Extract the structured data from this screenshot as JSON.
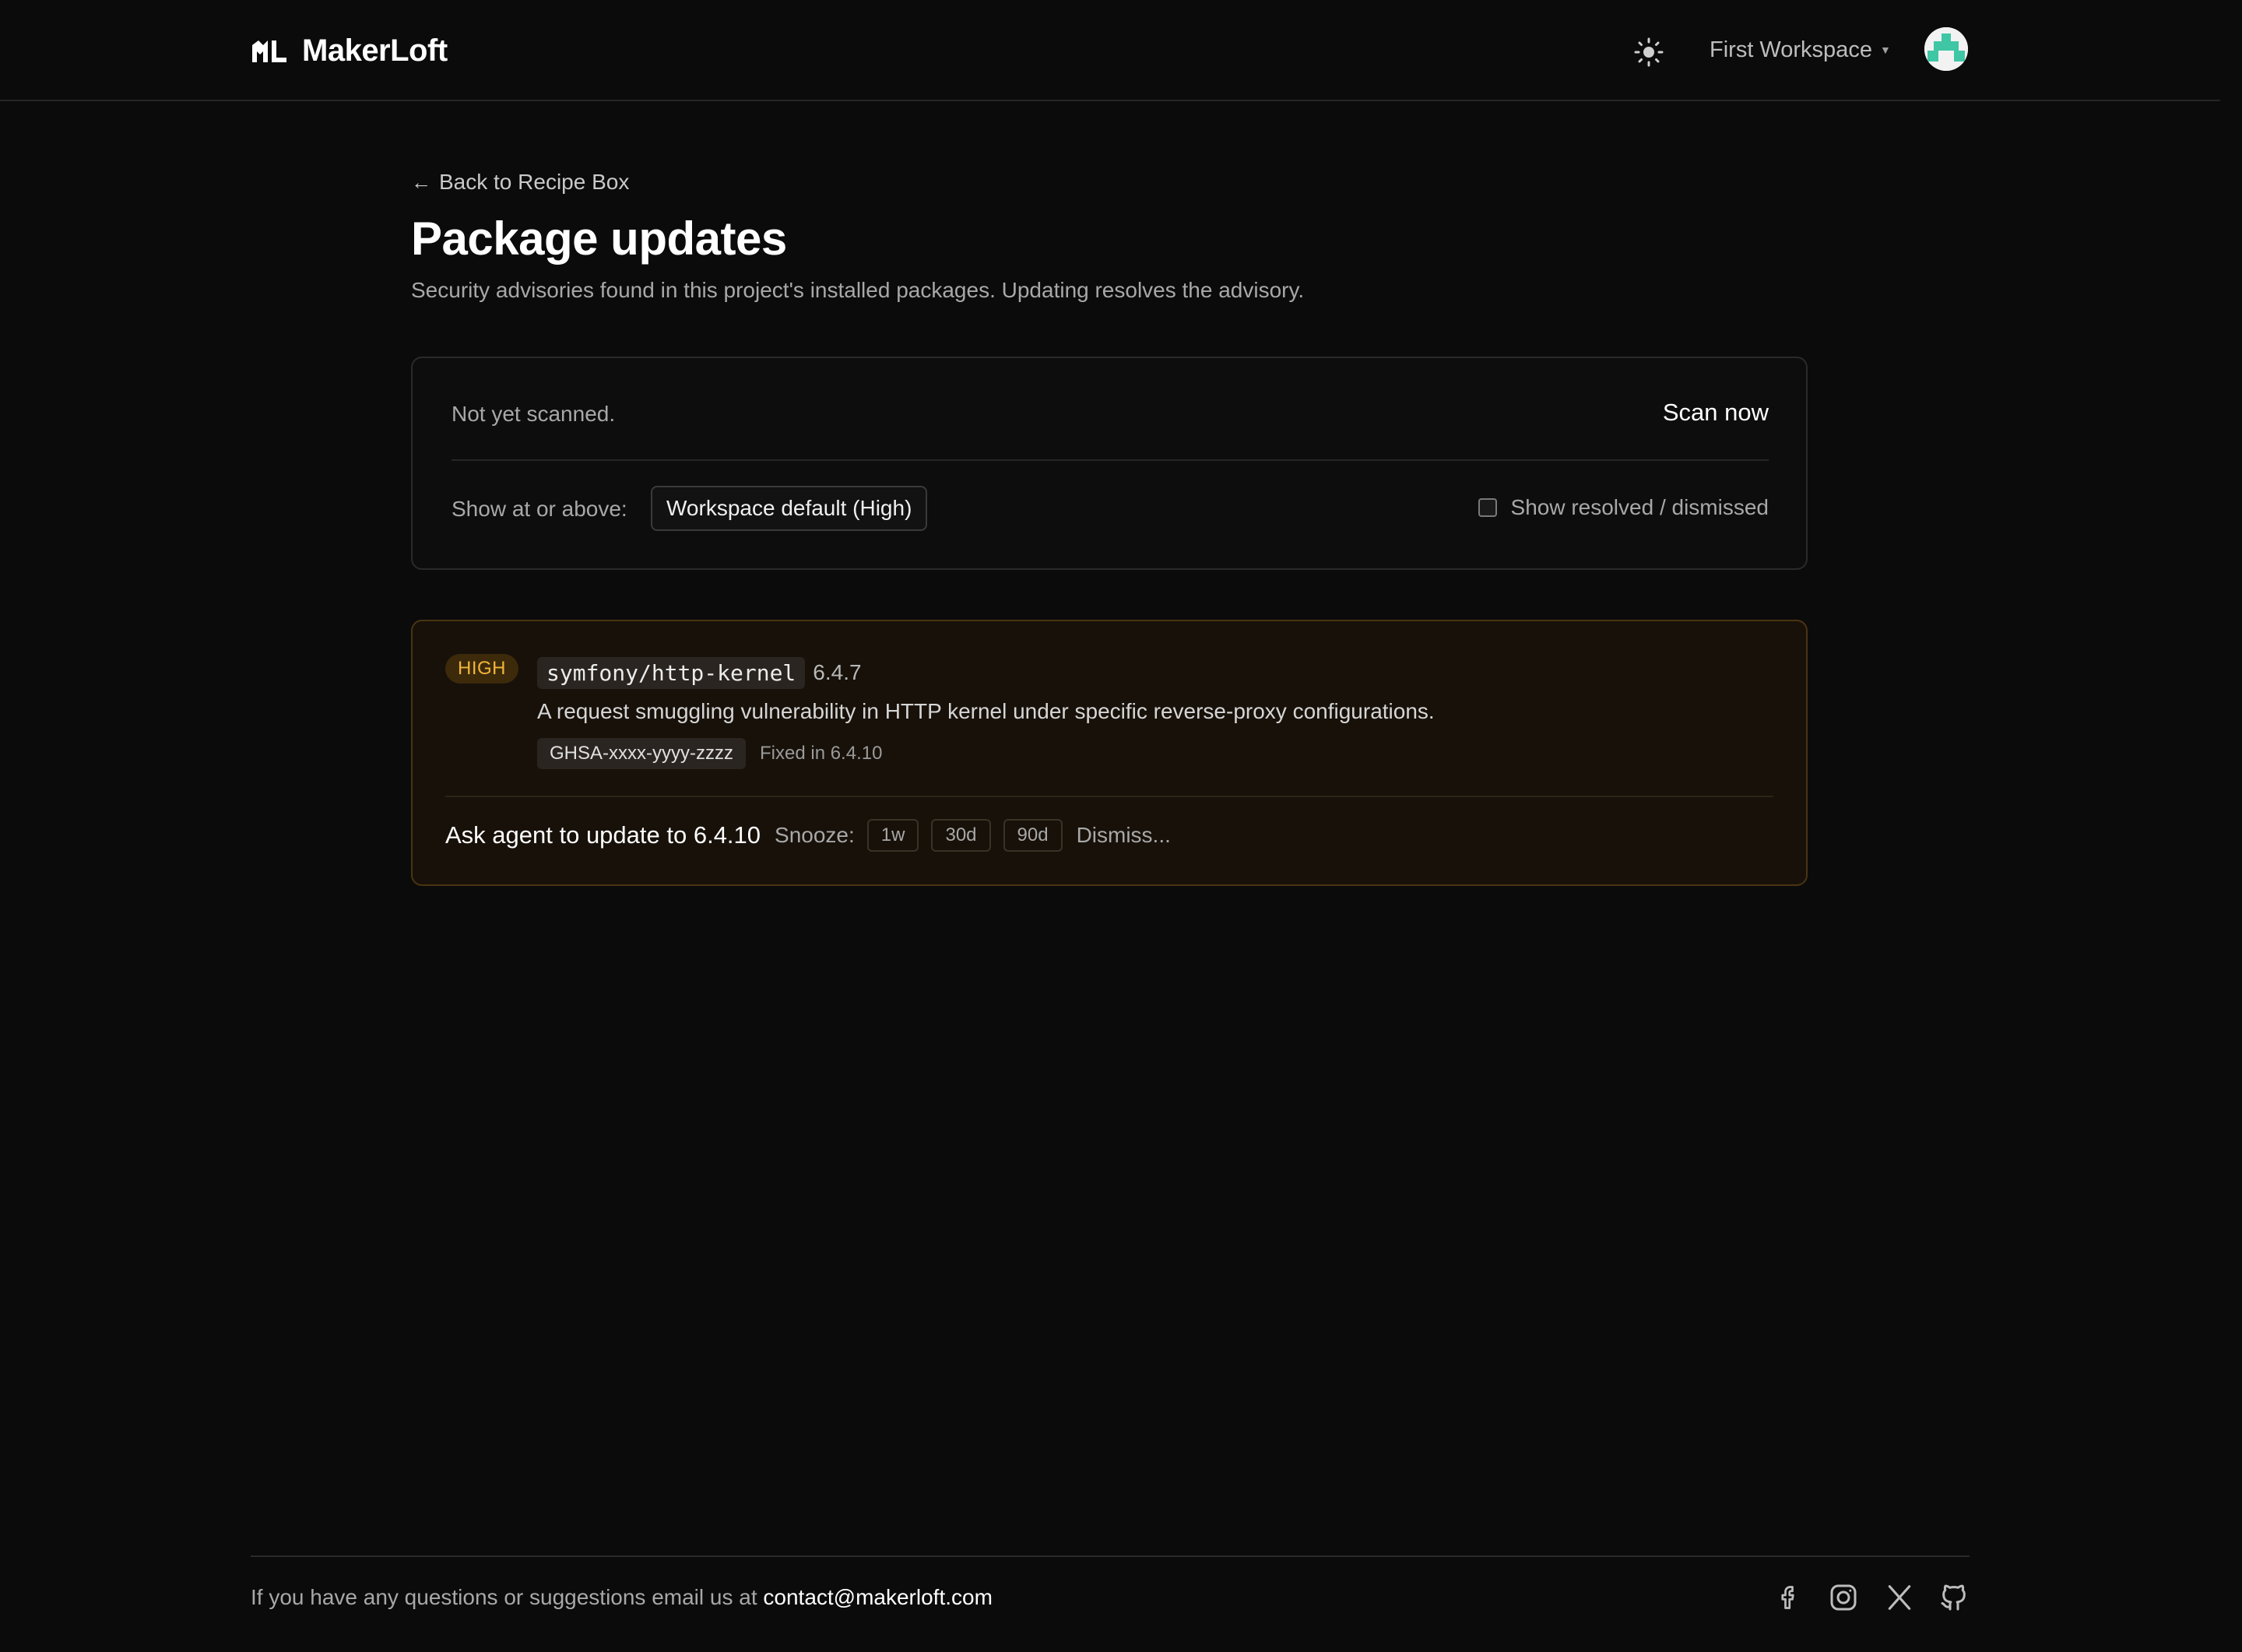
{
  "header": {
    "brand": "MakerLoft",
    "workspace": "First Workspace",
    "icons": {
      "theme": "sun-icon",
      "avatar": "user-avatar"
    }
  },
  "page": {
    "back_link": "Back to Recipe Box",
    "title": "Package updates",
    "subtitle": "Security advisories found in this project's installed packages. Updating resolves the advisory."
  },
  "scan": {
    "status": "Not yet scanned.",
    "scan_button": "Scan now",
    "filter_label": "Show at or above:",
    "filter_value": "Workspace default (High)",
    "show_resolved_label": "Show resolved / dismissed",
    "show_resolved_checked": false
  },
  "advisories": [
    {
      "severity": "HIGH",
      "package": "symfony/http-kernel",
      "installed_version": "6.4.7",
      "description": "A request smuggling vulnerability in HTTP kernel under specific reverse-proxy configurations.",
      "ghsa_id": "GHSA-xxxx-yyyy-zzzz",
      "fixed_in": "Fixed in 6.4.10",
      "ask_agent_label": "Ask agent to update to 6.4.10",
      "snooze_label": "Snooze:",
      "snooze_options": [
        "1w",
        "30d",
        "90d"
      ],
      "dismiss_label": "Dismiss..."
    }
  ],
  "footer": {
    "text": "If you have any questions or suggestions email us at",
    "email": "contact@makerloft.com",
    "social": [
      "facebook-icon",
      "instagram-icon",
      "x-icon",
      "github-icon"
    ]
  },
  "colors": {
    "background": "#0b0b0b",
    "severity_high": "#f2b53a",
    "advisory_border": "#4a3412"
  }
}
